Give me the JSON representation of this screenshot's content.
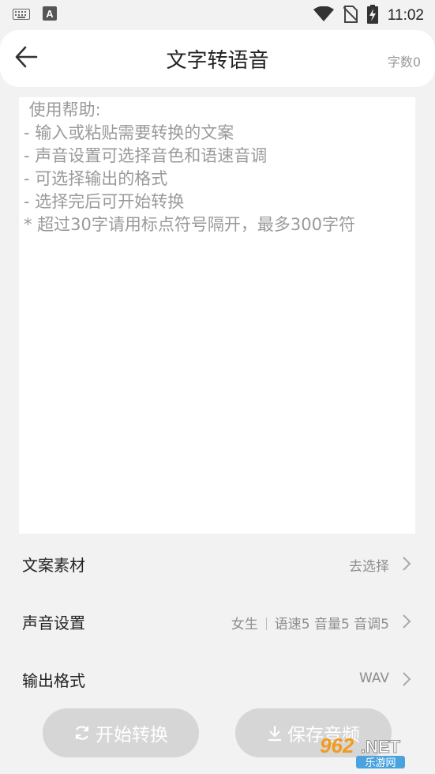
{
  "status_bar": {
    "time": "11:02"
  },
  "header": {
    "title": "文字转语音",
    "word_count": "字数0"
  },
  "editor": {
    "placeholder": " 使用帮助:\n- 输入或粘贴需要转换的文案\n- 声音设置可选择音色和语速音调\n- 可选择输出的格式\n- 选择完后可开始转换\n* 超过30字请用标点符号隔开，最多300字符"
  },
  "settings": {
    "material": {
      "label": "文案素材",
      "value": "去选择"
    },
    "voice": {
      "label": "声音设置",
      "voice_type": "女生",
      "params": "语速5 音量5 音调5"
    },
    "format": {
      "label": "输出格式",
      "value": "WAV"
    }
  },
  "buttons": {
    "start": "开始转换",
    "save": "保存音频"
  },
  "watermark": {
    "main": "962.NET",
    "sub": "乐游网"
  }
}
